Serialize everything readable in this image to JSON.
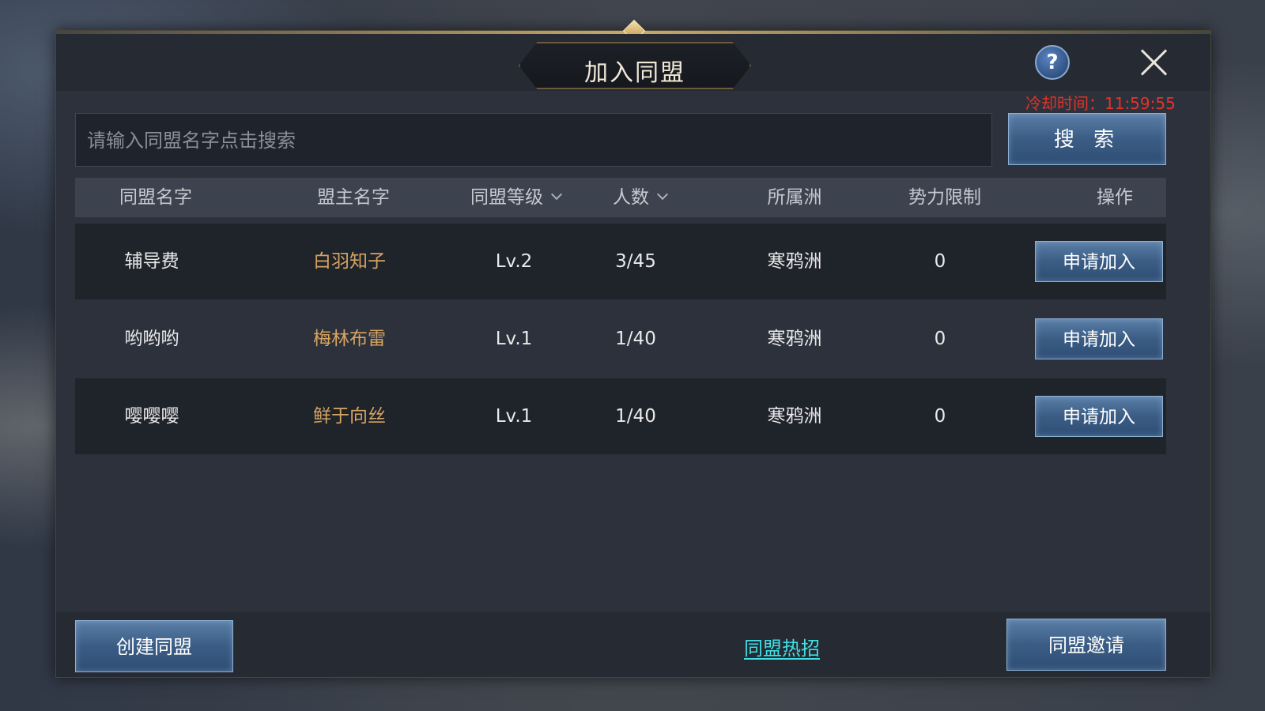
{
  "dialog": {
    "title": "加入同盟",
    "help_label": "?",
    "cooldown": "冷却时间：11:59:55"
  },
  "search": {
    "placeholder": "请输入同盟名字点击搜索",
    "button_label": "搜 索"
  },
  "table": {
    "headers": [
      "同盟名字",
      "盟主名字",
      "同盟等级",
      "人数",
      "所属洲",
      "势力限制",
      "操作"
    ],
    "rows": [
      {
        "name": "辅导费",
        "leader": "白羽知子",
        "level": "Lv.2",
        "members": "3/45",
        "continent": "寒鸦洲",
        "limit": "0",
        "action": "申请加入"
      },
      {
        "name": "哟哟哟",
        "leader": "梅林布雷",
        "level": "Lv.1",
        "members": "1/40",
        "continent": "寒鸦洲",
        "limit": "0",
        "action": "申请加入"
      },
      {
        "name": "嘤嘤嘤",
        "leader": "鲜于向丝",
        "level": "Lv.1",
        "members": "1/40",
        "continent": "寒鸦洲",
        "limit": "0",
        "action": "申请加入"
      }
    ]
  },
  "footer": {
    "create_label": "创建同盟",
    "hot_label": "同盟热招",
    "invite_label": "同盟邀请"
  },
  "colors": {
    "cooldown": "#e53329",
    "leader_name": "#d7a462",
    "link": "#3fe0e6",
    "button": "#3b5d85"
  },
  "icons": [
    "help-icon",
    "close-icon",
    "chevron-down-icon"
  ]
}
